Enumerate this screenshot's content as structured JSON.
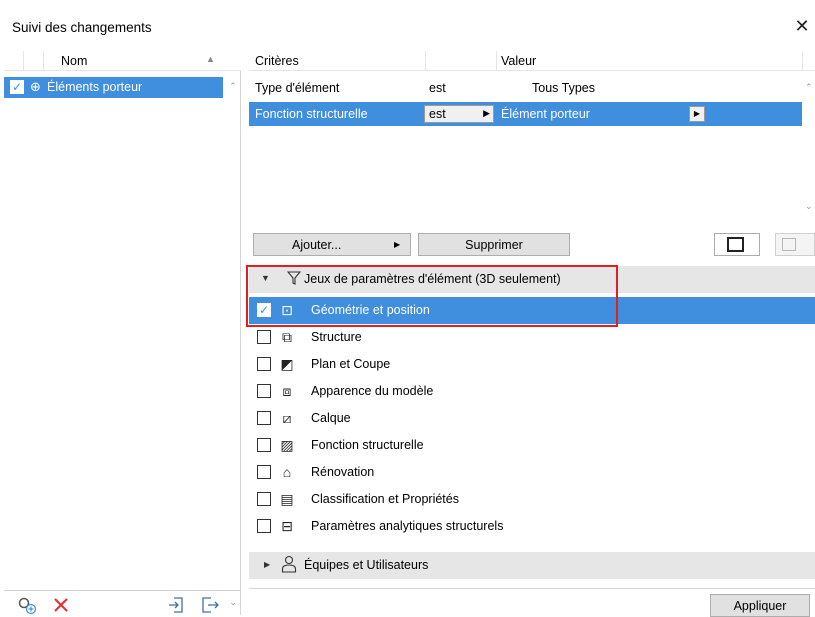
{
  "window": {
    "title": "Suivi des changements",
    "close_glyph": "✕"
  },
  "left_panel": {
    "header": {
      "name_label": "Nom",
      "sort_glyph": "▲"
    },
    "items": [
      {
        "label": "Éléments porteur",
        "checked": true,
        "icon": "search-zoom-icon"
      }
    ],
    "scroll_up": "⌃",
    "scroll_down": "⌄",
    "toolbar": [
      {
        "name": "add-search-icon",
        "glyph": "⊕"
      },
      {
        "name": "delete-icon",
        "glyph": "✕"
      },
      {
        "name": "import-icon",
        "glyph": "⇲"
      },
      {
        "name": "export-icon",
        "glyph": "⇨"
      }
    ]
  },
  "criteria": {
    "headers": {
      "criteria": "Critères",
      "value": "Valeur"
    },
    "rows": [
      {
        "criterion": "Type d'élément",
        "operator": "est",
        "value": "Tous Types"
      },
      {
        "criterion": "Fonction structurelle",
        "operator": "est",
        "value": "Élément porteur"
      }
    ],
    "dropdown_glyph": "▶"
  },
  "buttons": {
    "add": "Ajouter...",
    "delete": "Supprimer",
    "apply": "Appliquer"
  },
  "section_params": {
    "label": "Jeux de paramètres d'élément (3D seulement)",
    "expanded": true,
    "items": [
      {
        "label": "Géométrie et position",
        "checked": true,
        "selected": true,
        "icon": "geometry-icon",
        "glyph": "⊡"
      },
      {
        "label": "Structure",
        "checked": false,
        "icon": "structure-icon",
        "glyph": "⧉"
      },
      {
        "label": "Plan et Coupe",
        "checked": false,
        "icon": "plan-section-icon",
        "glyph": "◩"
      },
      {
        "label": "Apparence du modèle",
        "checked": false,
        "icon": "model-appearance-icon",
        "glyph": "⧈"
      },
      {
        "label": "Calque",
        "checked": false,
        "icon": "layer-icon",
        "glyph": "⧄"
      },
      {
        "label": "Fonction structurelle",
        "checked": false,
        "icon": "structural-function-icon",
        "glyph": "▨"
      },
      {
        "label": "Rénovation",
        "checked": false,
        "icon": "renovation-icon",
        "glyph": "⌂"
      },
      {
        "label": "Classification et Propriétés",
        "checked": false,
        "icon": "classification-icon",
        "glyph": "▤"
      },
      {
        "label": "Paramètres analytiques structurels",
        "checked": false,
        "icon": "analytical-icon",
        "glyph": "⊟"
      }
    ]
  },
  "section_teams": {
    "label": "Équipes et Utilisateurs",
    "expanded": false
  },
  "colors": {
    "selection": "#3f8fde",
    "highlight_border": "#e02020",
    "section_bg": "#e6e6e6",
    "delete_red": "#e0302a"
  }
}
